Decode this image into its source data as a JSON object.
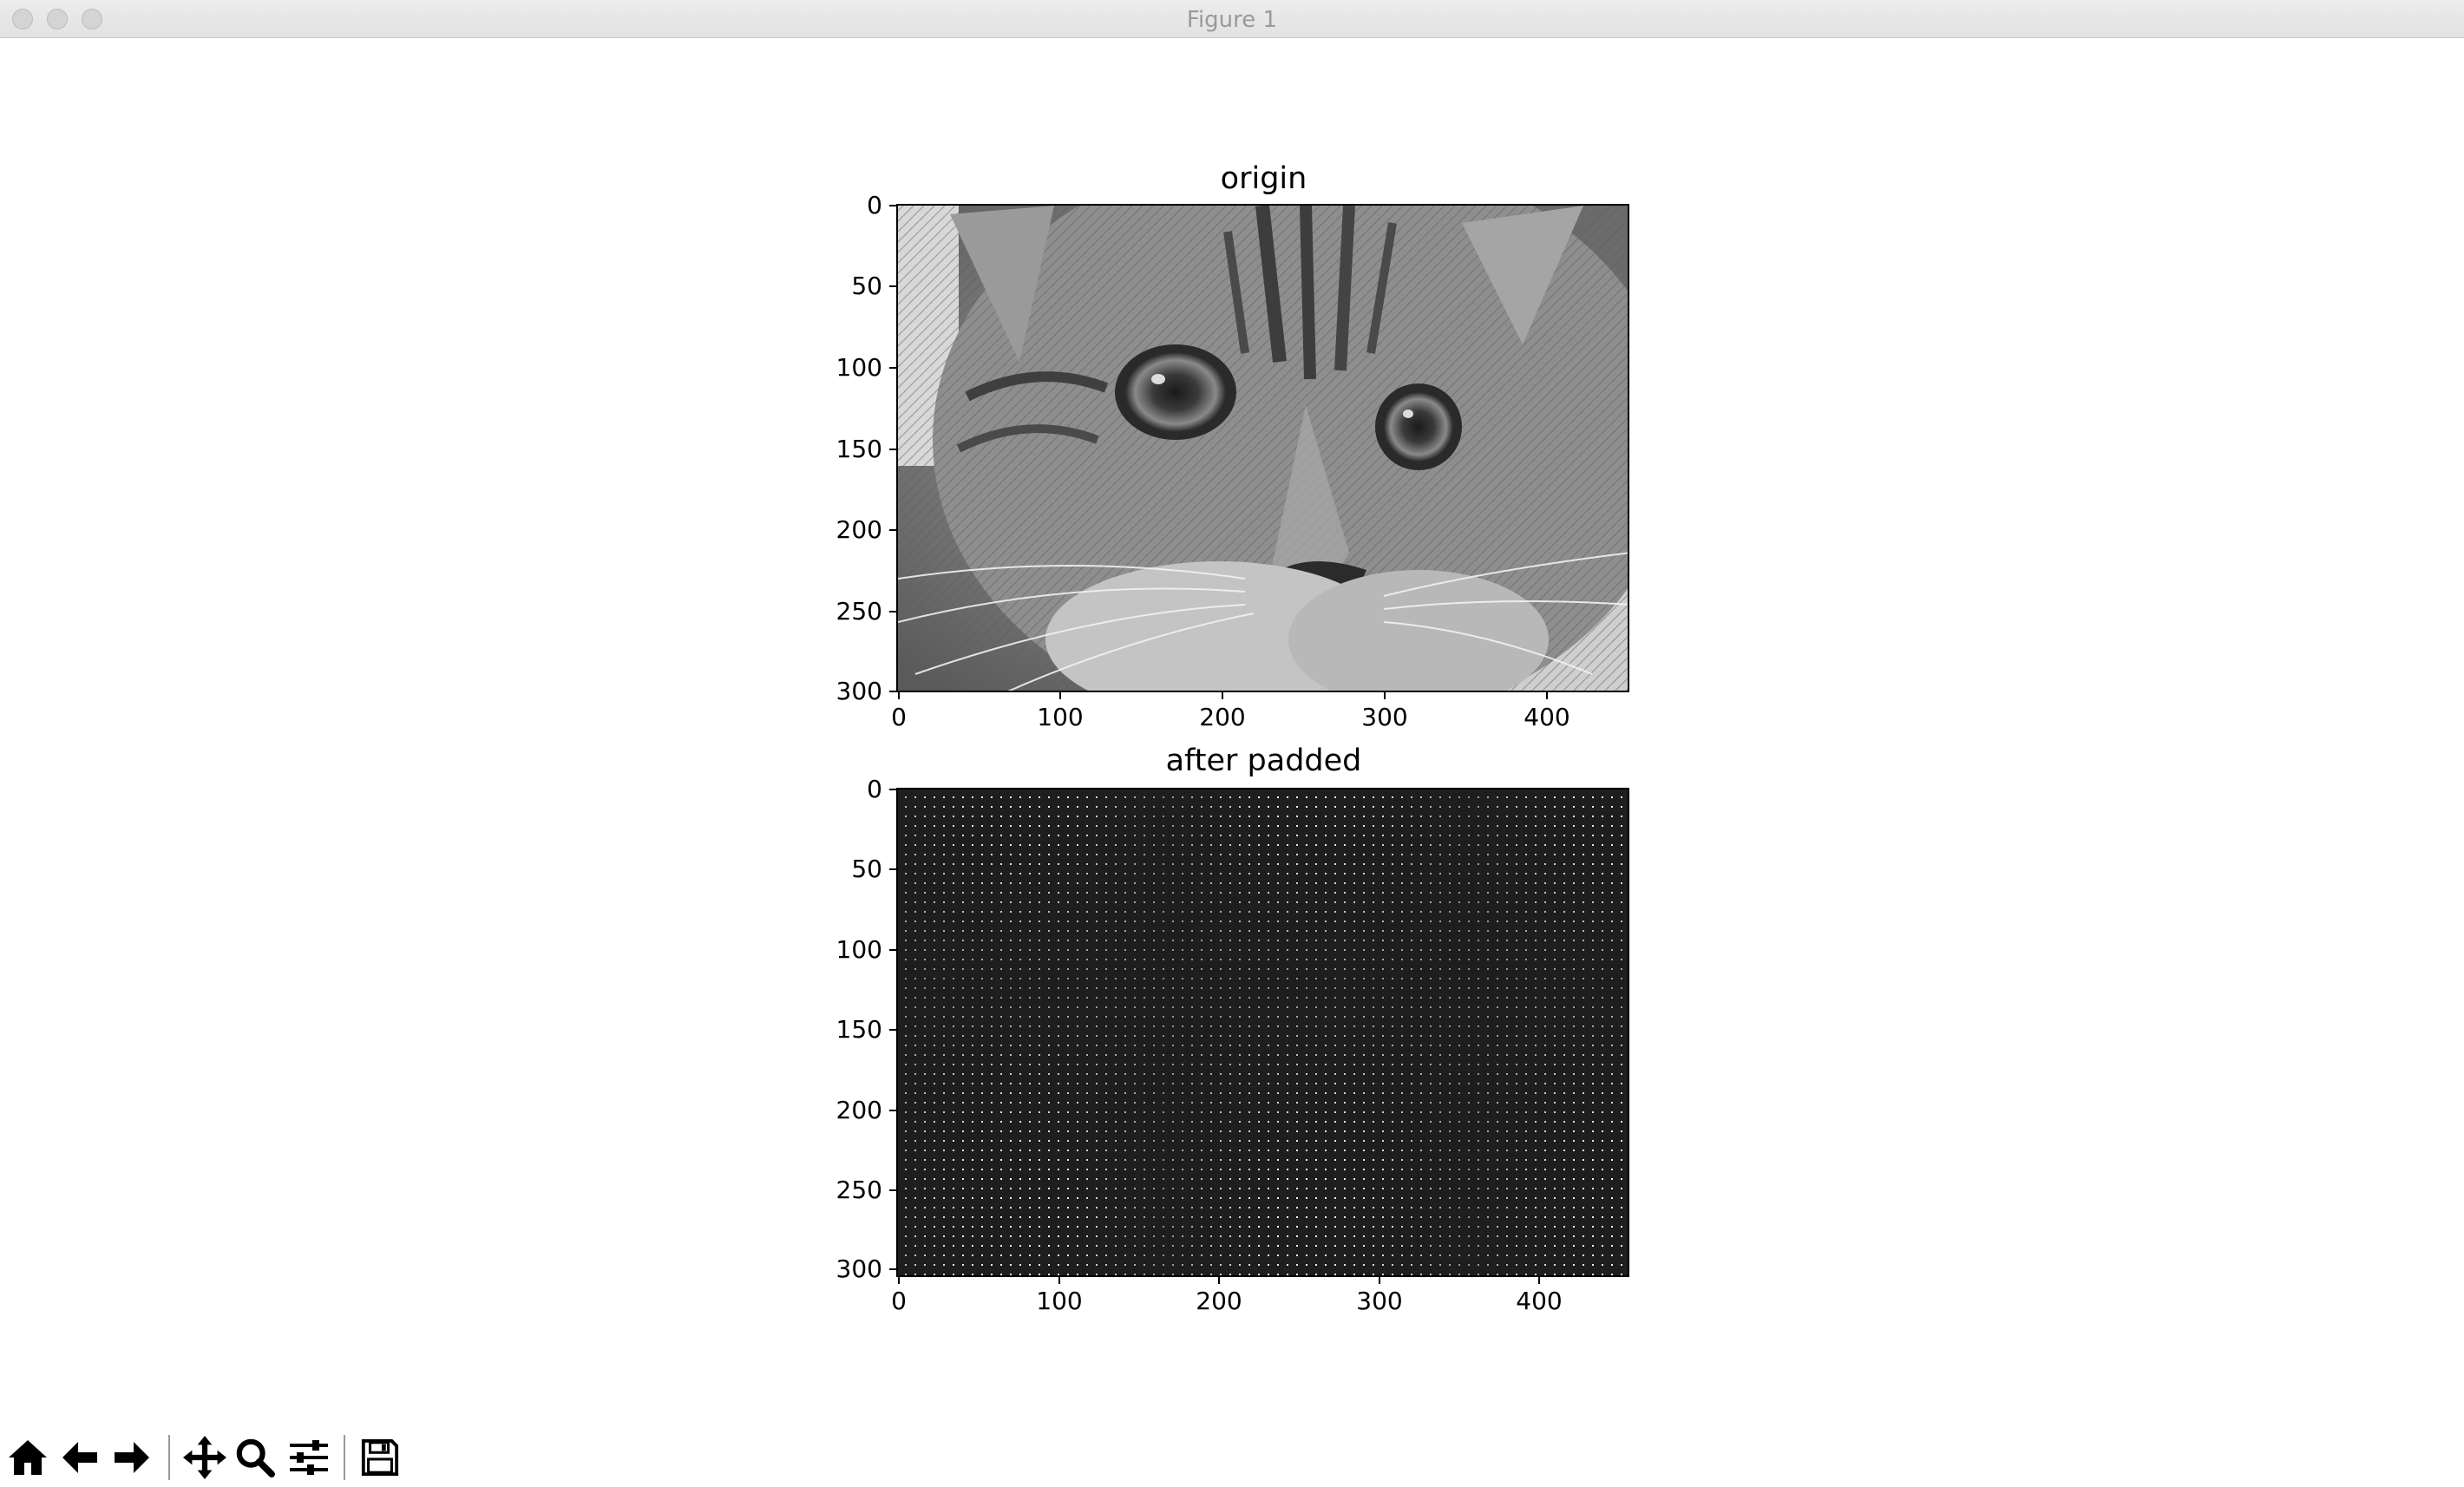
{
  "window": {
    "title": "Figure 1"
  },
  "toolbar": {
    "buttons": [
      {
        "name": "home-button",
        "icon": "home-icon"
      },
      {
        "name": "back-button",
        "icon": "arrow-left-icon"
      },
      {
        "name": "forward-button",
        "icon": "arrow-right-icon"
      },
      {
        "name": "pan-button",
        "icon": "move-icon"
      },
      {
        "name": "zoom-button",
        "icon": "magnifier-icon"
      },
      {
        "name": "configure-subplots-button",
        "icon": "sliders-icon"
      },
      {
        "name": "save-button",
        "icon": "floppy-disk-icon"
      }
    ]
  },
  "chart_data": [
    {
      "type": "image",
      "title": "origin",
      "xlabel": "",
      "ylabel": "",
      "xticks": [
        "0",
        "100",
        "200",
        "300",
        "400"
      ],
      "yticks": [
        "0",
        "50",
        "100",
        "150",
        "200",
        "250",
        "300"
      ],
      "xlim": [
        0,
        450
      ],
      "ylim": [
        300,
        0
      ],
      "colormap": "gray",
      "content": "grayscale photograph"
    },
    {
      "type": "image",
      "title": "after padded",
      "xlabel": "",
      "ylabel": "",
      "xticks": [
        "0",
        "100",
        "200",
        "300",
        "400"
      ],
      "yticks": [
        "0",
        "50",
        "100",
        "150",
        "200",
        "250",
        "300"
      ],
      "xlim": [
        0,
        455
      ],
      "ylim": [
        305,
        0
      ],
      "colormap": "gray",
      "content": "dark image with sparse bright dot grid"
    }
  ]
}
